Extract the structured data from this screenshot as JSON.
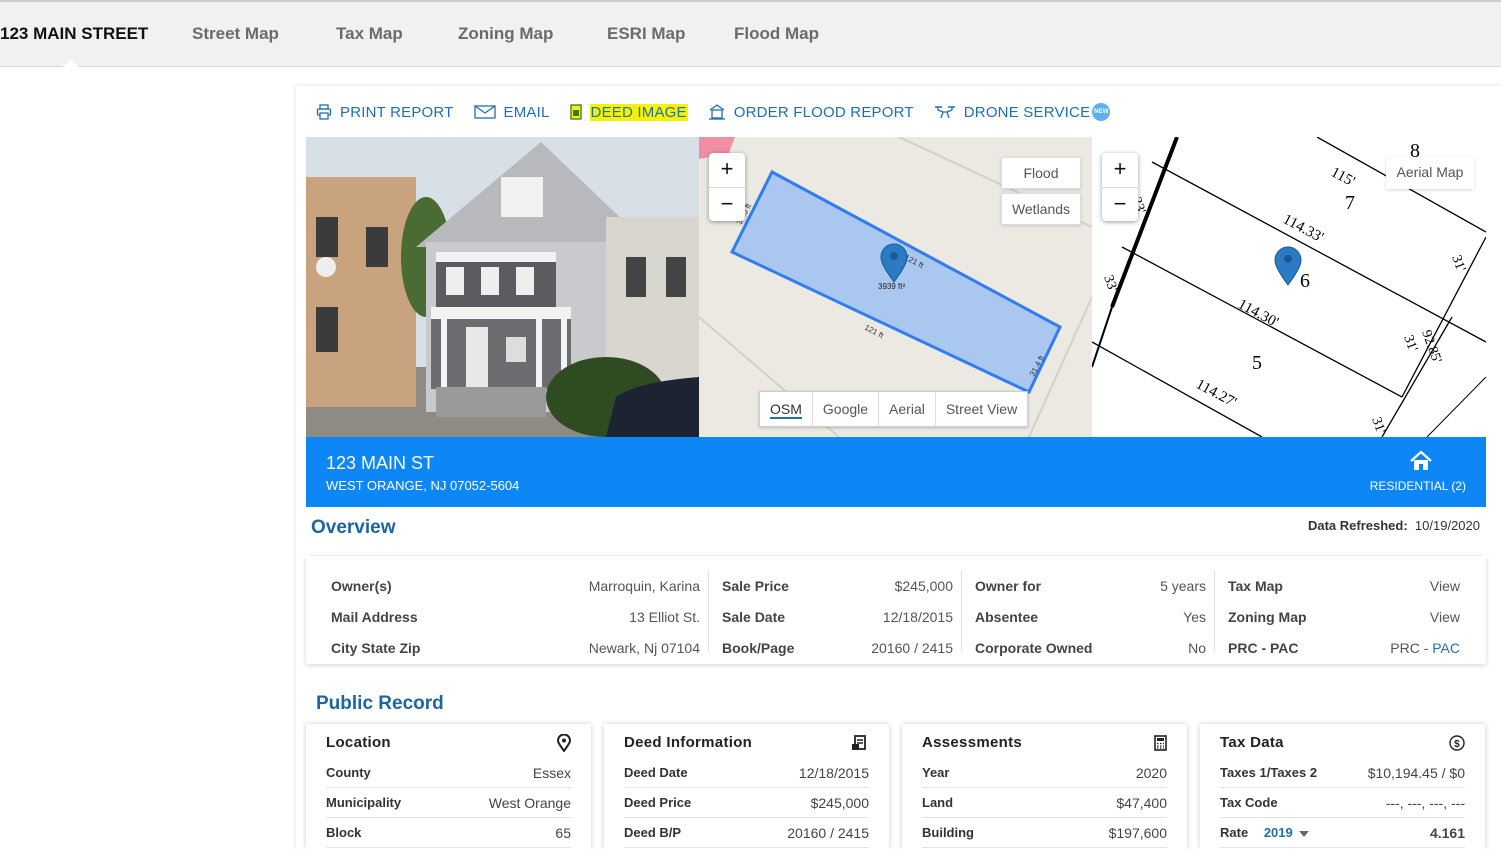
{
  "tabs": {
    "active": "123 MAIN STREET",
    "street_map": "Street Map",
    "tax_map": "Tax Map",
    "zoning_map": "Zoning Map",
    "esri_map": "ESRI Map",
    "flood_map": "Flood Map"
  },
  "actions": {
    "print": "PRINT REPORT",
    "email": "EMAIL",
    "deed": "DEED IMAGE",
    "flood": "ORDER FLOOD REPORT",
    "drone": "DRONE SERVICE",
    "drone_badge": "NEW"
  },
  "map1": {
    "zoom_in": "+",
    "zoom_out": "−",
    "flood": "Flood",
    "wetlands": "Wetlands",
    "area": "3939 ft²",
    "dim_top": "121 ft",
    "dim_bottom": "121 ft",
    "dim_left": "33.5 ft",
    "dim_right": "31.4 ft",
    "layers": [
      "OSM",
      "Google",
      "Aerial",
      "Street View"
    ]
  },
  "map2": {
    "zoom_in": "+",
    "zoom_out": "−",
    "aerial": "Aerial Map",
    "lots": [
      "8",
      "7",
      "6",
      "5"
    ],
    "dims": [
      "115'",
      "114.33'",
      "114.30'",
      "114.27'",
      "33'",
      "33'",
      "31'",
      "31'",
      "92.85'",
      "31'"
    ]
  },
  "banner": {
    "address": "123 MAIN ST",
    "city": "WEST ORANGE, NJ 07052-5604",
    "type": "RESIDENTIAL (2)",
    "color": "#0d87f5"
  },
  "overview": {
    "title": "Overview",
    "refreshed_label": "Data Refreshed:",
    "refreshed_value": "10/19/2020",
    "col1": [
      {
        "k": "Owner(s)",
        "v": "Marroquin, Karina"
      },
      {
        "k": "Mail Address",
        "v": "13 Elliot St."
      },
      {
        "k": "City State Zip",
        "v": "Newark, Nj 07104"
      }
    ],
    "col2": [
      {
        "k": "Sale Price",
        "v": "$245,000"
      },
      {
        "k": "Sale Date",
        "v": "12/18/2015"
      },
      {
        "k": "Book/Page",
        "v": "20160 / 2415"
      }
    ],
    "col3": [
      {
        "k": "Owner for",
        "v": "5 years"
      },
      {
        "k": "Absentee",
        "v": "Yes"
      },
      {
        "k": "Corporate Owned",
        "v": "No"
      }
    ],
    "col4": [
      {
        "k": "Tax Map",
        "v": "View"
      },
      {
        "k": "Zoning Map",
        "v": "View"
      },
      {
        "k": "PRC - PAC",
        "v1": "PRC - ",
        "v2": "PAC"
      }
    ]
  },
  "public_record": {
    "title": "Public Record",
    "location": {
      "title": "Location",
      "rows": [
        {
          "k": "County",
          "v": "Essex"
        },
        {
          "k": "Municipality",
          "v": "West Orange"
        },
        {
          "k": "Block",
          "v": "65"
        }
      ]
    },
    "deed": {
      "title": "Deed Information",
      "rows": [
        {
          "k": "Deed Date",
          "v": "12/18/2015"
        },
        {
          "k": "Deed Price",
          "v": "$245,000"
        },
        {
          "k": "Deed B/P",
          "v": "20160 / 2415"
        }
      ]
    },
    "assessments": {
      "title": "Assessments",
      "rows": [
        {
          "k": "Year",
          "v": "2020"
        },
        {
          "k": "Land",
          "v": "$47,400"
        },
        {
          "k": "Building",
          "v": "$197,600"
        }
      ]
    },
    "tax": {
      "title": "Tax Data",
      "rows": [
        {
          "k": "Taxes 1/Taxes 2",
          "v": "$10,194.45 / $0"
        },
        {
          "k": "Tax Code",
          "v": "---, ---, ---, ---"
        },
        {
          "k": "Rate",
          "year": "2019",
          "v": "4.161"
        }
      ]
    }
  }
}
